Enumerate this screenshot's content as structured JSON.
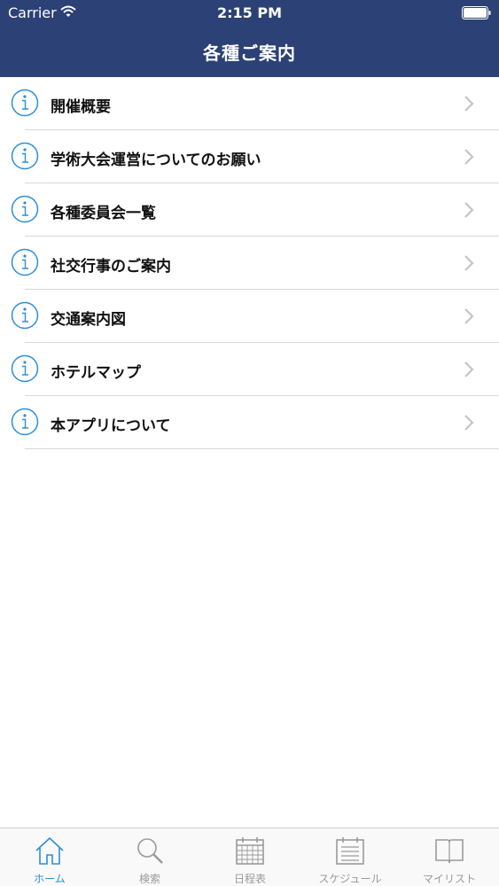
{
  "status_bar": {
    "carrier": "Carrier",
    "time": "2:15 PM"
  },
  "nav": {
    "title": "各種ご案内"
  },
  "menu": {
    "items": [
      {
        "label": "開催概要"
      },
      {
        "label": "学術大会運営についてのお願い"
      },
      {
        "label": "各種委員会一覧"
      },
      {
        "label": "社交行事のご案内"
      },
      {
        "label": "交通案内図"
      },
      {
        "label": "ホテルマップ"
      },
      {
        "label": "本アプリについて"
      }
    ]
  },
  "tabbar": {
    "tabs": [
      {
        "label": "ホーム",
        "icon": "home-icon",
        "active": true
      },
      {
        "label": "検索",
        "icon": "search-icon",
        "active": false
      },
      {
        "label": "日程表",
        "icon": "calendar-icon",
        "active": false
      },
      {
        "label": "スケジュール",
        "icon": "schedule-icon",
        "active": false
      },
      {
        "label": "マイリスト",
        "icon": "book-icon",
        "active": false
      }
    ]
  },
  "colors": {
    "header": "#2c4175",
    "accent": "#2d8fd8",
    "inactive": "#9a9a9a"
  }
}
